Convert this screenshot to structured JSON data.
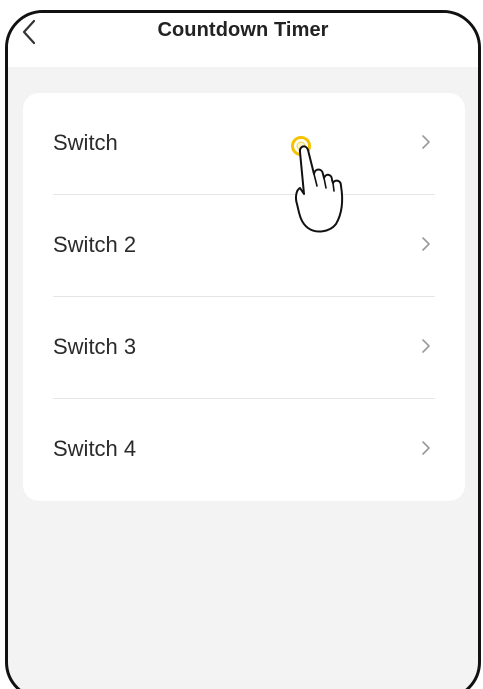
{
  "header": {
    "title": "Countdown Timer",
    "back_icon": "chevron-left-icon"
  },
  "list": {
    "items": [
      {
        "label": "Switch",
        "icon": "chevron-right-icon"
      },
      {
        "label": "Switch 2",
        "icon": "chevron-right-icon"
      },
      {
        "label": "Switch 3",
        "icon": "chevron-right-icon"
      },
      {
        "label": "Switch 4",
        "icon": "chevron-right-icon"
      }
    ]
  },
  "colors": {
    "background": "#f3f3f3",
    "card": "#ffffff",
    "text": "#2b2b2b",
    "chevron": "#9a9a9a",
    "tap_indicator": "#f5c400"
  }
}
